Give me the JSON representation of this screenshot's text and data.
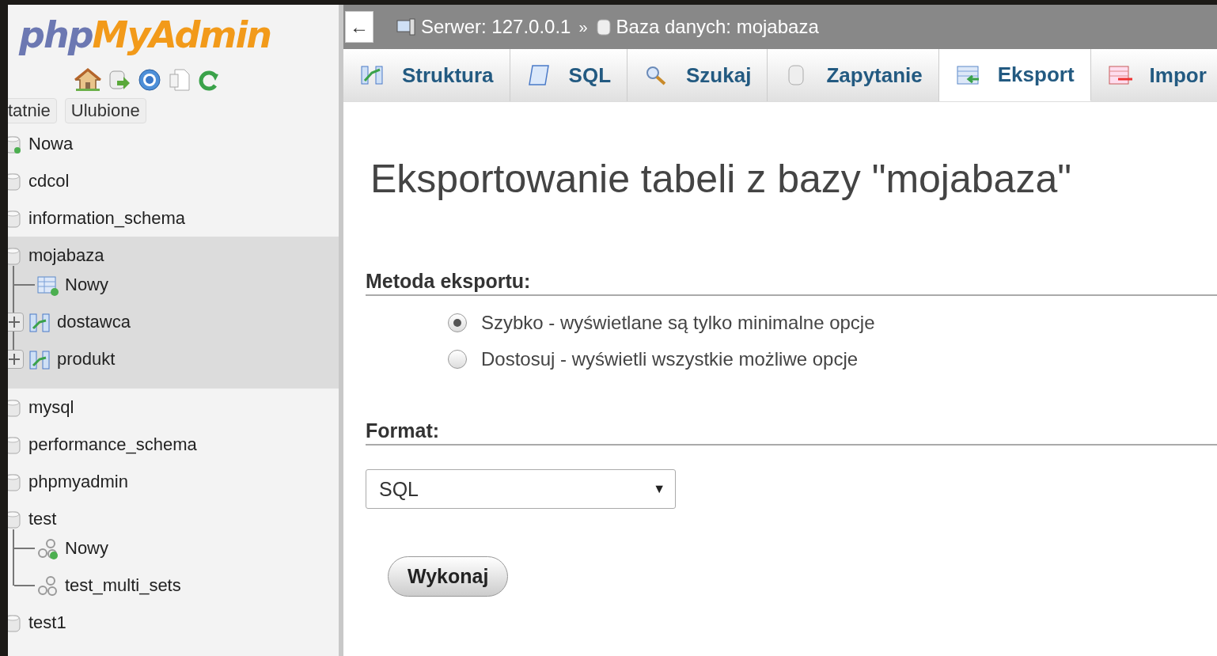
{
  "logo": {
    "part_1": "php",
    "part_2": "MyAdmin"
  },
  "sidebar_tabs": [
    {
      "label": "tatnie"
    },
    {
      "label": "Ulubione"
    }
  ],
  "tree": [
    {
      "kind": "new_db",
      "label": "Nowa",
      "selected": false
    },
    {
      "kind": "db",
      "label": "cdcol",
      "selected": false
    },
    {
      "kind": "db",
      "label": "information_schema",
      "selected": false
    },
    {
      "kind": "db",
      "label": "mojabaza",
      "selected": true,
      "children": [
        {
          "kind": "new_table",
          "label": "Nowy"
        },
        {
          "kind": "table",
          "label": "dostawca",
          "expanded": false
        },
        {
          "kind": "table",
          "label": "produkt",
          "expanded": false
        }
      ]
    },
    {
      "kind": "db",
      "label": "mysql",
      "selected": false
    },
    {
      "kind": "db",
      "label": "performance_schema",
      "selected": false
    },
    {
      "kind": "db",
      "label": "phpmyadmin",
      "selected": false
    },
    {
      "kind": "db",
      "label": "test",
      "selected": false,
      "children": [
        {
          "kind": "new_routine",
          "label": "Nowy"
        },
        {
          "kind": "routine",
          "label": "test_multi_sets"
        }
      ]
    },
    {
      "kind": "db",
      "label": "test1",
      "selected": false
    }
  ],
  "breadcrumb": {
    "back": "←",
    "server": "Serwer: 127.0.0.1",
    "separator": "»",
    "database": "Baza danych: mojabaza"
  },
  "tabs": [
    {
      "kind": "structure",
      "label": "Struktura",
      "selected": false
    },
    {
      "kind": "sql",
      "label": "SQL",
      "selected": false
    },
    {
      "kind": "search",
      "label": "Szukaj",
      "selected": false
    },
    {
      "kind": "query",
      "label": "Zapytanie",
      "selected": false
    },
    {
      "kind": "export",
      "label": "Eksport",
      "selected": true
    },
    {
      "kind": "import",
      "label": "Impor",
      "selected": false
    }
  ],
  "heading": "Eksportowanie tabeli z bazy \"mojabaza\"",
  "method": {
    "title": "Metoda eksportu:",
    "options": [
      {
        "label": "Szybko - wyświetlane są tylko minimalne opcje",
        "selected": true
      },
      {
        "label": "Dostosuj - wyświetli wszystkie możliwe opcje",
        "selected": false
      }
    ]
  },
  "format": {
    "title": "Format:",
    "value": "SQL",
    "caret": "▼"
  },
  "submit": "Wykonaj"
}
